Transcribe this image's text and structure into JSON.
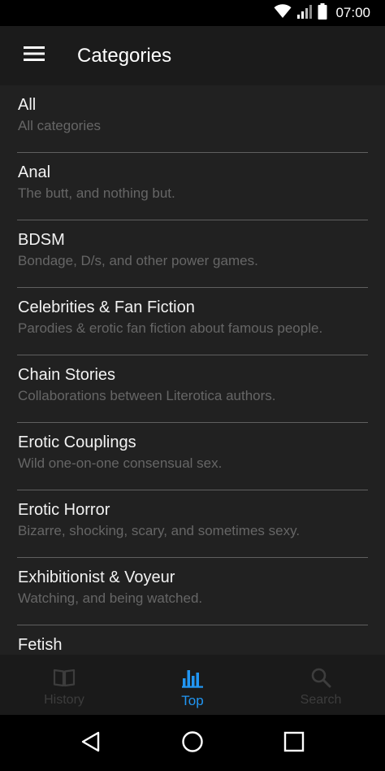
{
  "status_bar": {
    "time": "07:00",
    "icons": [
      "wifi-icon",
      "cellular-signal-icon",
      "battery-icon"
    ]
  },
  "app_bar": {
    "title": "Categories",
    "menu_icon": "hamburger-menu-icon"
  },
  "categories": [
    {
      "title": "All",
      "description": "All categories"
    },
    {
      "title": "Anal",
      "description": "The butt, and nothing but."
    },
    {
      "title": "BDSM",
      "description": "Bondage, D/s, and other power games."
    },
    {
      "title": "Celebrities & Fan Fiction",
      "description": "Parodies & erotic fan fiction about famous people."
    },
    {
      "title": "Chain Stories",
      "description": "Collaborations between Literotica authors."
    },
    {
      "title": "Erotic Couplings",
      "description": "Wild one-on-one consensual sex."
    },
    {
      "title": "Erotic Horror",
      "description": "Bizarre, shocking, scary, and sometimes sexy."
    },
    {
      "title": "Exhibitionist & Voyeur",
      "description": "Watching, and being watched."
    },
    {
      "title": "Fetish",
      "description": ""
    }
  ],
  "bottom_nav": {
    "tabs": [
      {
        "label": "History",
        "icon": "book-icon",
        "active": false
      },
      {
        "label": "Top",
        "icon": "bar-chart-icon",
        "active": true
      },
      {
        "label": "Search",
        "icon": "search-icon",
        "active": false
      }
    ],
    "active_color": "#2196f3",
    "inactive_color": "#3d3d3d"
  },
  "system_nav": {
    "icons": [
      "back-icon",
      "home-icon",
      "recents-icon"
    ]
  }
}
